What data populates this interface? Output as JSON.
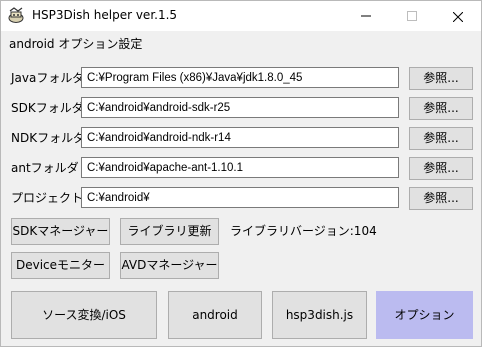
{
  "window": {
    "title": "HSP3Dish helper ver.1.5"
  },
  "section_title": "android オプション設定",
  "fields": [
    {
      "label": "Javaフォルダ",
      "value": "C:¥Program Files (x86)¥Java¥jdk1.8.0_45"
    },
    {
      "label": "SDKフォルダ",
      "value": "C:¥android¥android-sdk-r25"
    },
    {
      "label": "NDKフォルダ",
      "value": "C:¥android¥android-ndk-r14"
    },
    {
      "label": "antフォルダ",
      "value": "C:¥android¥apache-ant-1.10.1"
    },
    {
      "label": "プロジェクト",
      "value": "C:¥android¥"
    }
  ],
  "browse_label": "参照...",
  "tools": {
    "sdk_manager": "SDKマネージャー",
    "library_update": "ライブラリ更新",
    "library_version": "ライブラリバージョン:104",
    "device_monitor": "Deviceモニター",
    "avd_manager": "AVDマネージャー"
  },
  "tabs": {
    "source_convert": "ソース変換/iOS",
    "android": "android",
    "hsp3dish_js": "hsp3dish.js",
    "option": "オプション"
  },
  "colors": {
    "active_tab": "#bbbbf0"
  }
}
